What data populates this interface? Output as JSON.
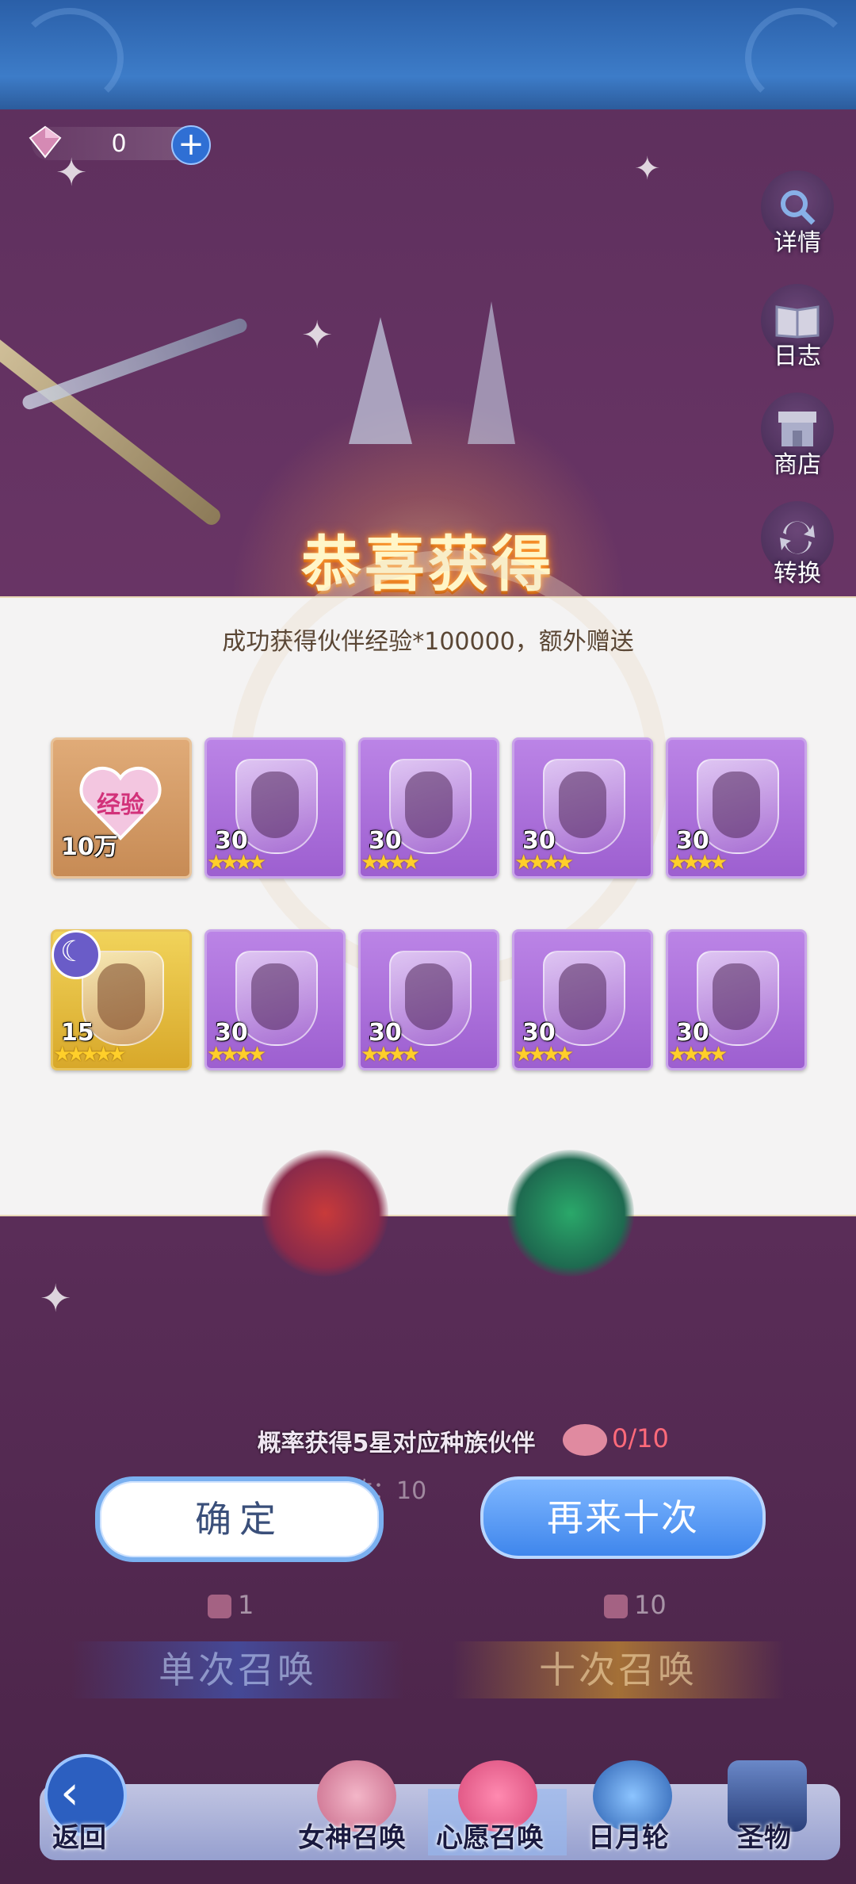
{
  "currency": {
    "value": "0",
    "plus": "+"
  },
  "side_buttons": [
    {
      "label": "详情",
      "icon": "magnifier-icon"
    },
    {
      "label": "日志",
      "icon": "book-icon"
    },
    {
      "label": "商店",
      "icon": "shop-icon"
    },
    {
      "label": "转换",
      "icon": "convert-icon"
    }
  ],
  "reward": {
    "title": "恭喜获得",
    "message": "成功获得伙伴经验*100000，额外赠送",
    "exp_item": {
      "label": "经验",
      "count": "10万"
    },
    "items": [
      {
        "count": "30",
        "stars": "★★★★"
      },
      {
        "count": "30",
        "stars": "★★★★"
      },
      {
        "count": "30",
        "stars": "★★★★"
      },
      {
        "count": "30",
        "stars": "★★★★"
      },
      {
        "count": "15",
        "stars": "★★★★★"
      },
      {
        "count": "30",
        "stars": "★★★★"
      },
      {
        "count": "30",
        "stars": "★★★★"
      },
      {
        "count": "30",
        "stars": "★★★★"
      },
      {
        "count": "30",
        "stars": "★★★★"
      }
    ]
  },
  "summon": {
    "hint": "概率获得5星对应种族伙伴",
    "wish": "0/10",
    "count_line": "唤次数：10",
    "confirm": "确定",
    "again": "再来十次",
    "single_cost": "1",
    "ten_cost": "10",
    "single": "单次召唤",
    "ten": "十次召唤"
  },
  "nav": {
    "back": "返回",
    "tabs": [
      "女神召唤",
      "心愿召唤",
      "日月轮",
      "圣物"
    ]
  }
}
